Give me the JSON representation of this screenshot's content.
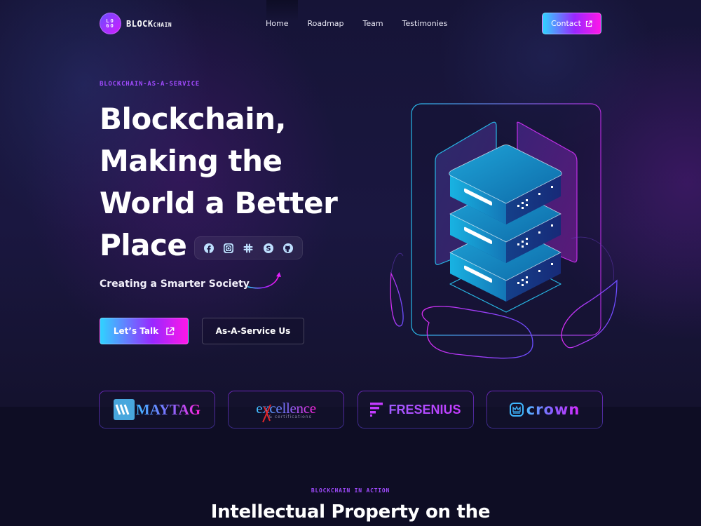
{
  "nav": {
    "logo_mark_top": "LO",
    "logo_mark_bottom": "GO",
    "brand_main": "BLOCK",
    "brand_sub": "CHAIN",
    "links": [
      {
        "label": "Home"
      },
      {
        "label": "Roadmap"
      },
      {
        "label": "Team"
      },
      {
        "label": "Testimonies"
      }
    ],
    "contact_label": "Contact",
    "contact_icon": "external-link-icon"
  },
  "hero": {
    "eyebrow": "BLOCKCHAIN-AS-A-SERVICE",
    "headline_lines": [
      "Blockchain,",
      "Making the",
      "World a Better",
      "Place"
    ],
    "socials": [
      {
        "icon": "facebook-icon",
        "label": "Facebook"
      },
      {
        "icon": "instagram-icon",
        "label": "Instagram"
      },
      {
        "icon": "slack-icon",
        "label": "Slack"
      },
      {
        "icon": "skype-icon",
        "label": "Skype"
      },
      {
        "icon": "github-icon",
        "label": "GitHub"
      }
    ],
    "subline": "Creating a Smarter Society",
    "primary_button": "Let’s Talk",
    "secondary_button": "As-A-Service Us",
    "illustration": "server-stack-illustration"
  },
  "partners": [
    {
      "name": "MAYTAG"
    },
    {
      "name": "excellence",
      "sub": "& certifications"
    },
    {
      "name": "FRESENIUS"
    },
    {
      "name": "crown"
    }
  ],
  "next_section": {
    "eyebrow": "BLOCKCHAIN IN ACTION",
    "title": "Intellectual Property on the"
  },
  "colors": {
    "accent_purple": "#a14bff",
    "gradient_start": "#2fd4ff",
    "gradient_mid": "#9a27ff",
    "gradient_end": "#ff17e8",
    "background": "#161437"
  }
}
